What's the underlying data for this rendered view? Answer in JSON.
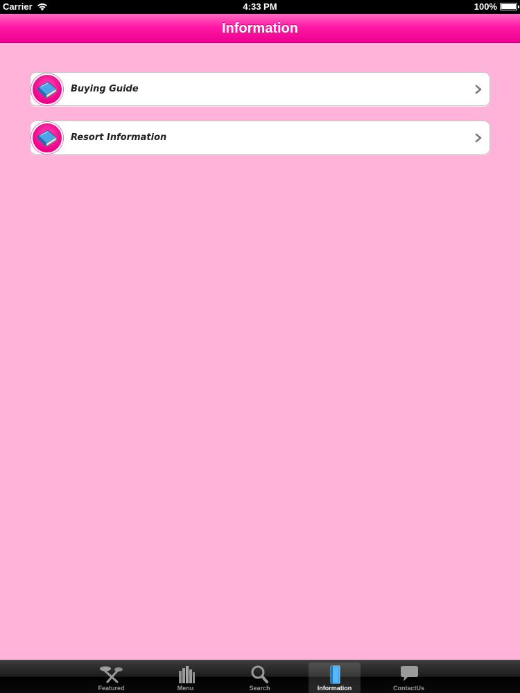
{
  "status_bar": {
    "carrier": "Carrier",
    "time": "4:33 PM",
    "battery": "100%"
  },
  "nav": {
    "title": "Information"
  },
  "list": {
    "items": [
      {
        "label": "Buying Guide",
        "icon": "book-icon"
      },
      {
        "label": "Resort Information",
        "icon": "book-icon"
      }
    ]
  },
  "tab_bar": {
    "tabs": [
      {
        "label": "Featured",
        "icon": "featured-icon",
        "selected": false
      },
      {
        "label": "Menu",
        "icon": "menu-icon",
        "selected": false
      },
      {
        "label": "Search",
        "icon": "search-icon",
        "selected": false
      },
      {
        "label": "Information",
        "icon": "book-icon",
        "selected": true
      },
      {
        "label": "ContactUs",
        "icon": "chat-bubble-icon",
        "selected": false
      }
    ]
  },
  "colors": {
    "background": "#ffb3d8",
    "nav_accent": "#ff1aa5",
    "tab_selected": "#ffffff"
  }
}
